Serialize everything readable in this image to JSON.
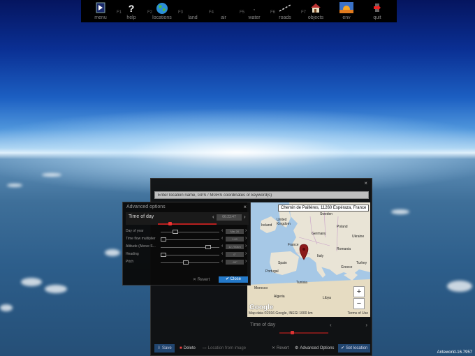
{
  "toolbar": {
    "items": [
      {
        "fkey": "",
        "label": "menu",
        "icon": "menu-icon"
      },
      {
        "fkey": "F1",
        "label": "help",
        "icon": "question-icon"
      },
      {
        "fkey": "F2",
        "label": "locations",
        "icon": "globe-icon"
      },
      {
        "fkey": "F3",
        "label": "land",
        "icon": "land-icon"
      },
      {
        "fkey": "F4",
        "label": "air",
        "icon": "air-icon"
      },
      {
        "fkey": "F5",
        "label": "water",
        "icon": "water-icon"
      },
      {
        "fkey": "F6",
        "label": "roads",
        "icon": "roads-icon"
      },
      {
        "fkey": "F7",
        "label": "objects",
        "icon": "house-icon"
      },
      {
        "fkey": "",
        "label": "env",
        "icon": "sunset-icon"
      },
      {
        "fkey": "",
        "label": "quit",
        "icon": "exit-icon"
      }
    ]
  },
  "location_window": {
    "search_placeholder": "Enter location name, GPS / MGRS coordinates or keyword(s)",
    "close_label": "×",
    "map": {
      "address": "Chemin de Paillères, 11260 Espéraza, France",
      "labels": [
        "Ireland",
        "United Kingdom",
        "Sweden",
        "Poland",
        "Germany",
        "Ukraine",
        "France",
        "Romania",
        "Italy",
        "Spain",
        "Portugal",
        "Greece",
        "Turkey",
        "Morocco",
        "Algeria",
        "Tunisia",
        "Libya"
      ],
      "zoom_in": "+",
      "zoom_out": "−",
      "google": "Google",
      "attribution": "Map data ©2016 Google, INEGI   1000 km",
      "terms": "Terms of Use"
    },
    "time_of_day": {
      "label": "Time of day",
      "prev": "‹",
      "next": "›"
    },
    "buttons": {
      "save": "Save",
      "delete": "Delete",
      "location_from_image": "Location from image",
      "revert": "Revert",
      "advanced_options": "Advanced Options",
      "set_location": "Set location"
    }
  },
  "advanced_options": {
    "title": "Advanced options",
    "close_label": "×",
    "time_of_day": {
      "label": "Time of day",
      "value": "06:23:47",
      "position": 0.18
    },
    "rows": [
      {
        "label": "Day of year",
        "value": "Mar 26",
        "position": 0.22
      },
      {
        "label": "Time flow multiplier",
        "value": "1.00",
        "position": 0.0
      },
      {
        "label": "Altitude (Above S...",
        "value": "12,750km",
        "position": 0.84
      },
      {
        "label": "Heading",
        "value": "0°",
        "position": 0.0
      },
      {
        "label": "Pitch",
        "value": "-90°",
        "position": 0.42
      }
    ],
    "revert": "Revert",
    "close": "Close"
  },
  "version": "Anteworld-16.7957"
}
